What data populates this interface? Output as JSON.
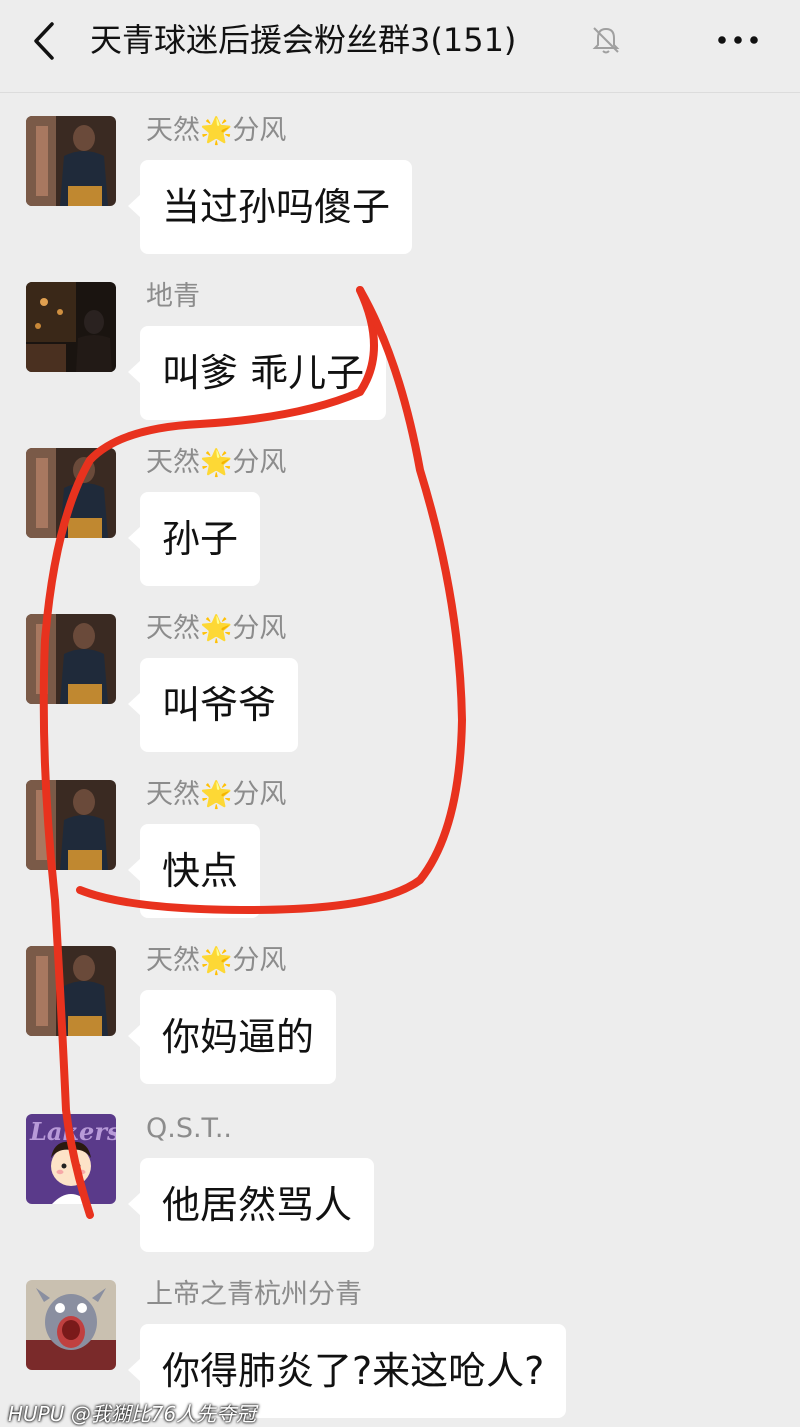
{
  "header": {
    "title": "天青球迷后援会粉丝群3(151)",
    "back_icon": "chevron-left-icon",
    "mute_icon": "bell-muted-icon",
    "more_icon": "more-dots-icon"
  },
  "messages": [
    {
      "sender_pre": "天然",
      "sender_post": "分风",
      "emoji": "🌟",
      "text": "当过孙吗傻子"
    },
    {
      "sender_pre": "地青",
      "sender_post": "",
      "emoji": "",
      "text": "叫爹 乖儿子"
    },
    {
      "sender_pre": "天然",
      "sender_post": "分风",
      "emoji": "🌟",
      "text": "孙子"
    },
    {
      "sender_pre": "天然",
      "sender_post": "分风",
      "emoji": "🌟",
      "text": "叫爷爷"
    },
    {
      "sender_pre": "天然",
      "sender_post": "分风",
      "emoji": "🌟",
      "text": "快点"
    },
    {
      "sender_pre": "天然",
      "sender_post": "分风",
      "emoji": "🌟",
      "text": "你妈逼的"
    },
    {
      "sender_pre": "Q.S.T..",
      "sender_post": "",
      "emoji": "",
      "text": "他居然骂人"
    },
    {
      "sender_pre": "上帝之青杭州分青",
      "sender_post": "",
      "emoji": "",
      "text": "你得肺炎了?来这呛人?"
    }
  ],
  "watermark": "HUPU @我猢比76人先夺冠",
  "colors": {
    "background": "#ededed",
    "bubble": "#ffffff",
    "sender": "#8c8c8c",
    "annotation": "#e8321e"
  }
}
